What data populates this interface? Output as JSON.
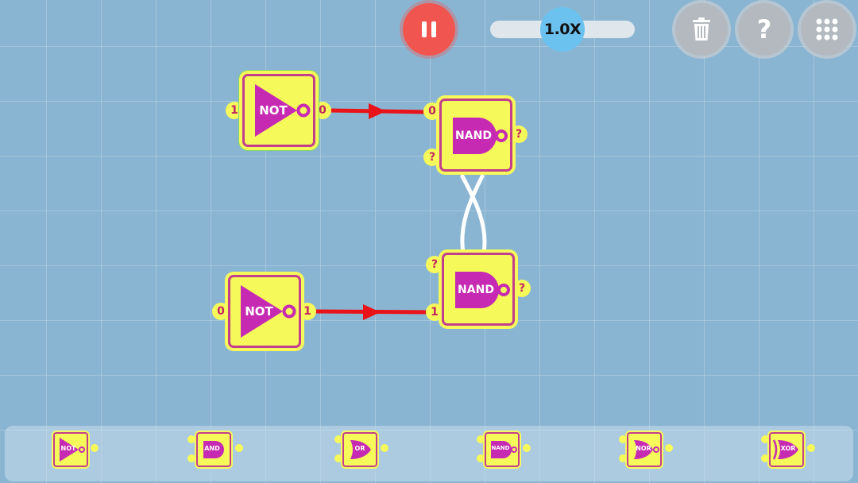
{
  "toolbar": {
    "speed_label": "1.0X",
    "pause_icon": "pause-icon",
    "trash_icon": "trash-icon",
    "help_label": "?",
    "menu_icon": "grid-menu-icon"
  },
  "colors": {
    "background": "#8ab5d2",
    "gate_fill": "#f6f95a",
    "gate_border": "#c23f8d",
    "gate_symbol": "#c62ab2",
    "active_wire": "#e8141a",
    "unknown_wire": "#ffffff",
    "pause_button": "#f0564f",
    "speed_knob": "#6cc2ef"
  },
  "circuit": {
    "not_top": {
      "label": "NOT",
      "input": "1",
      "output": "0"
    },
    "not_bottom": {
      "label": "NOT",
      "input": "0",
      "output": "1"
    },
    "nand_top": {
      "label": "NAND",
      "input_a": "0",
      "input_b": "?",
      "output": "?"
    },
    "nand_bottom": {
      "label": "NAND",
      "input_a": "?",
      "input_b": "1",
      "output": "?"
    }
  },
  "palette": {
    "items": [
      {
        "label": "NOT",
        "icon": "not-gate-icon"
      },
      {
        "label": "AND",
        "icon": "and-gate-icon"
      },
      {
        "label": "OR",
        "icon": "or-gate-icon"
      },
      {
        "label": "NAND",
        "icon": "nand-gate-icon"
      },
      {
        "label": "NOR",
        "icon": "nor-gate-icon"
      },
      {
        "label": "XOR",
        "icon": "xor-gate-icon"
      }
    ]
  }
}
